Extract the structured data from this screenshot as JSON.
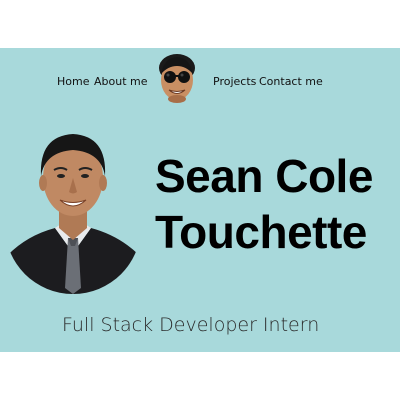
{
  "nav": {
    "home_label": "Home",
    "about_label": "About me",
    "projects_label": "Projects",
    "contact_label": "Contact me"
  },
  "hero": {
    "first_name": "Sean Cole",
    "last_name": "Touchette",
    "role": "Full Stack Developer Intern"
  },
  "colors": {
    "background": "#a8d9db",
    "page_outer": "#ffffff",
    "text": "#000000"
  },
  "icons": {
    "nav_avatar": "avatar-sunglasses-icon",
    "portrait": "profile-photo"
  }
}
